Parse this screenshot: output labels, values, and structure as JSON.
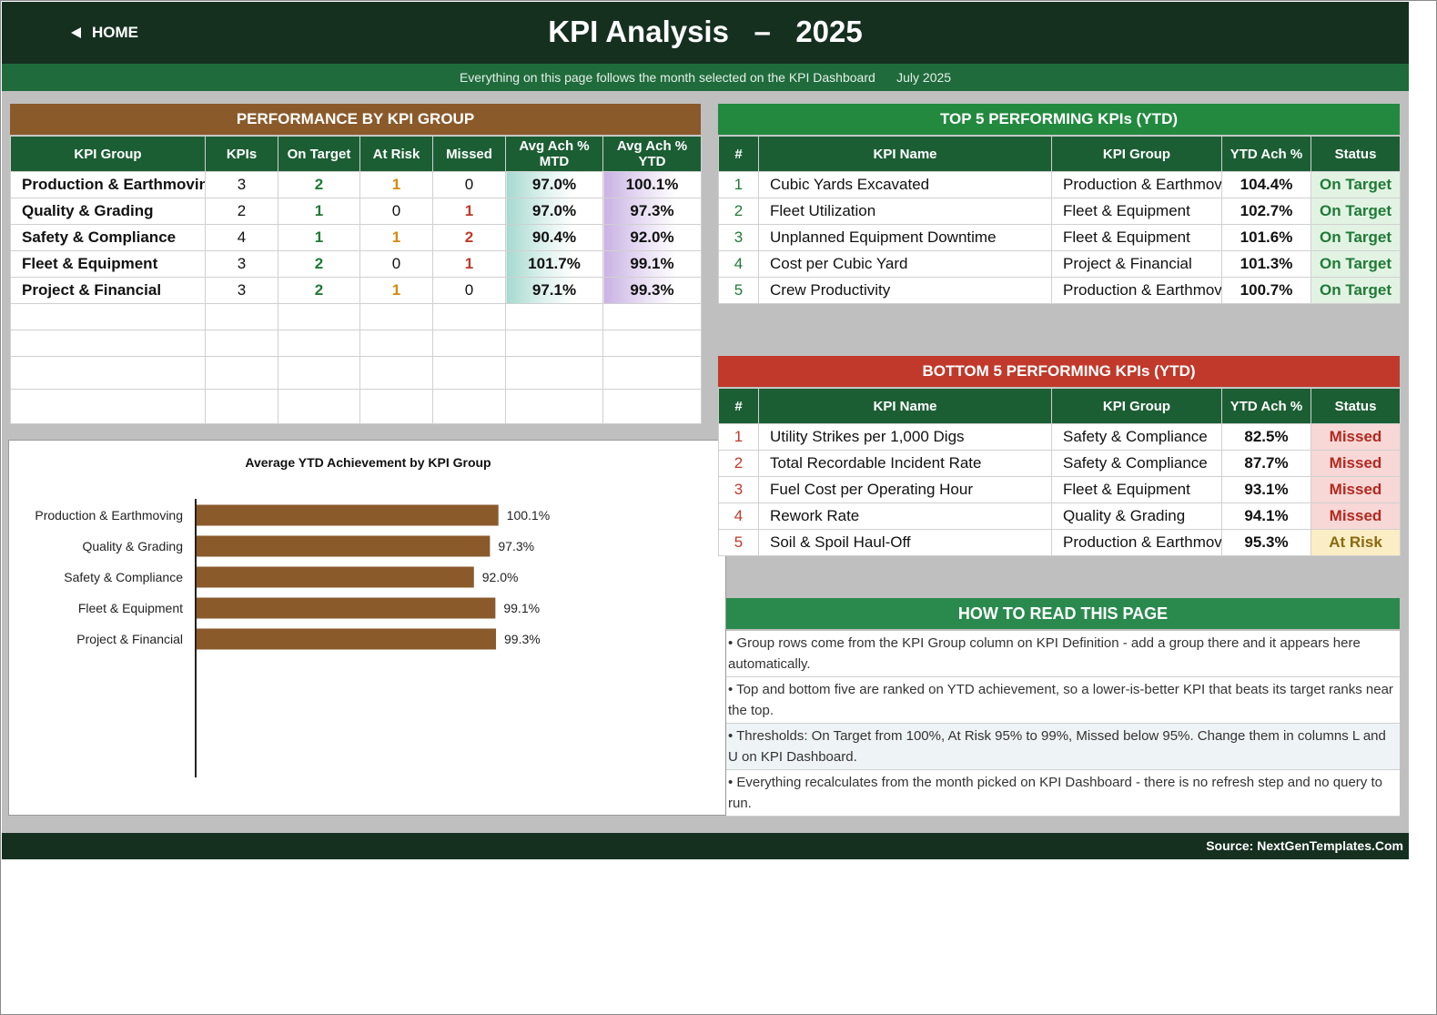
{
  "header": {
    "home_label": "HOME",
    "title": "KPI Analysis   –   2025"
  },
  "subbar": {
    "note": "Everything on this page follows the month selected on the KPI Dashboard",
    "month": "July 2025"
  },
  "group_panel": {
    "title": "PERFORMANCE BY KPI GROUP",
    "columns": [
      "KPI Group",
      "KPIs",
      "On Target",
      "At Risk",
      "Missed",
      "Avg Ach % MTD",
      "Avg Ach % YTD"
    ],
    "rows": [
      {
        "group": "Production & Earthmoving",
        "kpis": "3",
        "on_target": "2",
        "at_risk": "1",
        "missed": "0",
        "mtd": "97.0%",
        "ytd": "100.1%"
      },
      {
        "group": "Quality & Grading",
        "kpis": "2",
        "on_target": "1",
        "at_risk": "0",
        "missed": "1",
        "mtd": "97.0%",
        "ytd": "97.3%"
      },
      {
        "group": "Safety & Compliance",
        "kpis": "4",
        "on_target": "1",
        "at_risk": "1",
        "missed": "2",
        "mtd": "90.4%",
        "ytd": "92.0%"
      },
      {
        "group": "Fleet & Equipment",
        "kpis": "3",
        "on_target": "2",
        "at_risk": "0",
        "missed": "1",
        "mtd": "101.7%",
        "ytd": "99.1%"
      },
      {
        "group": "Project & Financial",
        "kpis": "3",
        "on_target": "2",
        "at_risk": "1",
        "missed": "0",
        "mtd": "97.1%",
        "ytd": "99.3%"
      }
    ]
  },
  "top5": {
    "title": "TOP 5 PERFORMING KPIs  (YTD)",
    "columns": [
      "#",
      "KPI Name",
      "KPI Group",
      "YTD Ach %",
      "Status"
    ],
    "rows": [
      {
        "rank": "1",
        "name": "Cubic Yards Excavated",
        "group": "Production & Earthmoving",
        "ytd": "104.4%",
        "status": "On Target"
      },
      {
        "rank": "2",
        "name": "Fleet Utilization",
        "group": "Fleet & Equipment",
        "ytd": "102.7%",
        "status": "On Target"
      },
      {
        "rank": "3",
        "name": "Unplanned Equipment Downtime",
        "group": "Fleet & Equipment",
        "ytd": "101.6%",
        "status": "On Target"
      },
      {
        "rank": "4",
        "name": "Cost per Cubic Yard",
        "group": "Project & Financial",
        "ytd": "101.3%",
        "status": "On Target"
      },
      {
        "rank": "5",
        "name": "Crew Productivity",
        "group": "Production & Earthmoving",
        "ytd": "100.7%",
        "status": "On Target"
      }
    ]
  },
  "bottom5": {
    "title": "BOTTOM 5 PERFORMING KPIs  (YTD)",
    "columns": [
      "#",
      "KPI Name",
      "KPI Group",
      "YTD Ach %",
      "Status"
    ],
    "rows": [
      {
        "rank": "1",
        "name": "Utility Strikes per 1,000 Digs",
        "group": "Safety & Compliance",
        "ytd": "82.5%",
        "status": "Missed"
      },
      {
        "rank": "2",
        "name": "Total Recordable Incident Rate",
        "group": "Safety & Compliance",
        "ytd": "87.7%",
        "status": "Missed"
      },
      {
        "rank": "3",
        "name": "Fuel Cost per Operating Hour",
        "group": "Fleet & Equipment",
        "ytd": "93.1%",
        "status": "Missed"
      },
      {
        "rank": "4",
        "name": "Rework Rate",
        "group": "Quality & Grading",
        "ytd": "94.1%",
        "status": "Missed"
      },
      {
        "rank": "5",
        "name": "Soil & Spoil Haul-Off",
        "group": "Production & Earthmoving",
        "ytd": "95.3%",
        "status": "At Risk"
      }
    ]
  },
  "howto": {
    "title": "HOW TO READ THIS PAGE",
    "items": [
      "•  Group rows come from the KPI Group column on KPI Definition - add a group there and it appears here automatically.",
      "•  Top and bottom five are ranked on YTD achievement, so a lower-is-better KPI that beats its target ranks near the top.",
      "•  Thresholds: On Target from 100%, At Risk 95% to 99%, Missed below 95%. Change them in columns L and U on KPI Dashboard.",
      "•  Everything recalculates from the month picked on KPI Dashboard - there is no refresh step and no query to run."
    ]
  },
  "footer": {
    "source": "Source: NextGenTemplates.Com"
  },
  "colors": {
    "dark_green": "#163020",
    "brown": "#8a5a2b",
    "top_green": "#22893f",
    "bottom_red": "#c0392b"
  },
  "chart_data": {
    "type": "bar",
    "orientation": "horizontal",
    "title": "Average YTD Achievement by KPI Group",
    "categories": [
      "Production & Earthmoving",
      "Quality & Grading",
      "Safety & Compliance",
      "Fleet & Equipment",
      "Project & Financial"
    ],
    "values": [
      100.1,
      97.3,
      92.0,
      99.1,
      99.3
    ],
    "value_labels": [
      "100.1%",
      "97.3%",
      "92.0%",
      "99.1%",
      "99.3%"
    ],
    "xlim": [
      0,
      170
    ],
    "bar_color": "#8a5a2b",
    "grid": false,
    "legend": "none"
  }
}
